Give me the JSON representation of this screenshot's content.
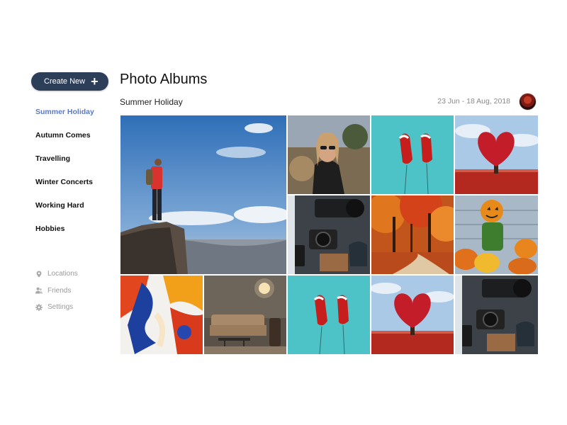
{
  "sidebar": {
    "create_label": "Create New",
    "items": [
      {
        "label": "Summer Holiday",
        "active": true
      },
      {
        "label": "Autumn Comes"
      },
      {
        "label": "Travelling"
      },
      {
        "label": "Winter Concerts"
      },
      {
        "label": "Working Hard"
      },
      {
        "label": "Hobbies"
      }
    ],
    "links": [
      {
        "label": "Locations",
        "icon": "location-pin-icon"
      },
      {
        "label": "Friends",
        "icon": "friends-icon"
      },
      {
        "label": "Settings",
        "icon": "gear-icon"
      }
    ]
  },
  "header": {
    "title": "Photo Albums",
    "album_name": "Summer Holiday",
    "date_range": "23 Jun - 18 Aug, 2018"
  },
  "photos": [
    {
      "subject": "hiker on cliff under blue sky"
    },
    {
      "subject": "woman with sunglasses"
    },
    {
      "subject": "red sneakers on teal background"
    },
    {
      "subject": "red heart-shaped tree"
    },
    {
      "subject": "camera gear flat lay"
    },
    {
      "subject": "autumn forest path"
    },
    {
      "subject": "child with pumpkin mask"
    },
    {
      "subject": "abstract colorful painting"
    },
    {
      "subject": "living room with sofa"
    },
    {
      "subject": "red sneakers on teal background"
    },
    {
      "subject": "red heart-shaped tree"
    },
    {
      "subject": "camera gear flat lay"
    }
  ],
  "colors": {
    "accent": "#5b79c4",
    "button": "#2d3e58",
    "muted": "#9a9a9a"
  }
}
